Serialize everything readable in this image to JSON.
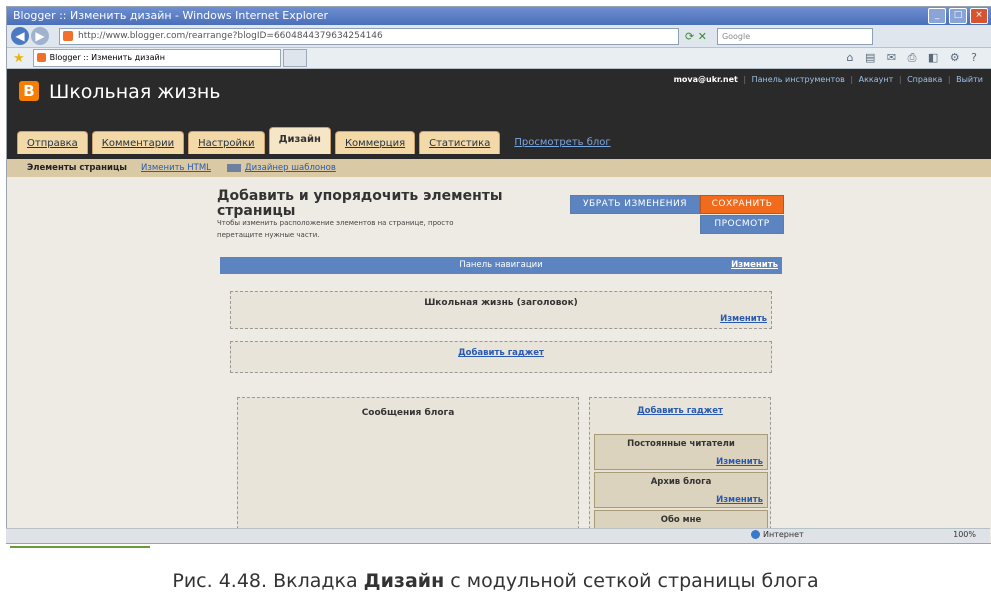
{
  "browser": {
    "window_title": "Blogger :: Изменить дизайн - Windows Internet Explorer",
    "url": "http://www.blogger.com/rearrange?blogID=6604844379634254146",
    "search_placeholder": "Google",
    "tab_title": "Blogger :: Изменить дизайн",
    "status_zone": "Интернет",
    "zoom": "100%"
  },
  "blogger": {
    "logo_letter": "B",
    "blog_name": "Школьная жизнь",
    "user": "mova@ukr.net",
    "links": [
      "Панель инструментов",
      "Аккаунт",
      "Справка",
      "Выйти"
    ],
    "tabs": [
      "Отправка",
      "Комментарии",
      "Настройки",
      "Дизайн",
      "Коммерция",
      "Статистика"
    ],
    "active_tab": "Дизайн",
    "view_blog": "Просмотреть блог",
    "subtabs": {
      "active": "Элементы страницы",
      "edit_html": "Изменить HTML",
      "template_designer": "Дизайнер шаблонов"
    }
  },
  "layout": {
    "heading": "Добавить и упорядочить элементы страницы",
    "hint": "Чтобы изменить расположение элементов на странице, просто перетащите нужные части.",
    "revert_button": "УБРАТЬ ИЗМЕНЕНИЯ",
    "save_button": "СОХРАНИТЬ",
    "preview_button": "ПРОСМОТР",
    "nav_panel": "Панель навигации",
    "edit": "Изменить",
    "header_label": "Школьная жизнь (заголовок)",
    "add_gadget": "Добавить гаджет",
    "blog_posts": "Сообщения блога",
    "widgets": [
      "Постоянные читатели",
      "Архив блога",
      "Обо мне"
    ]
  },
  "caption": {
    "prefix": "Рис. 4.48. Вкладка ",
    "bold": "Дизайн",
    "suffix": " с модульной сеткой страницы блога"
  }
}
